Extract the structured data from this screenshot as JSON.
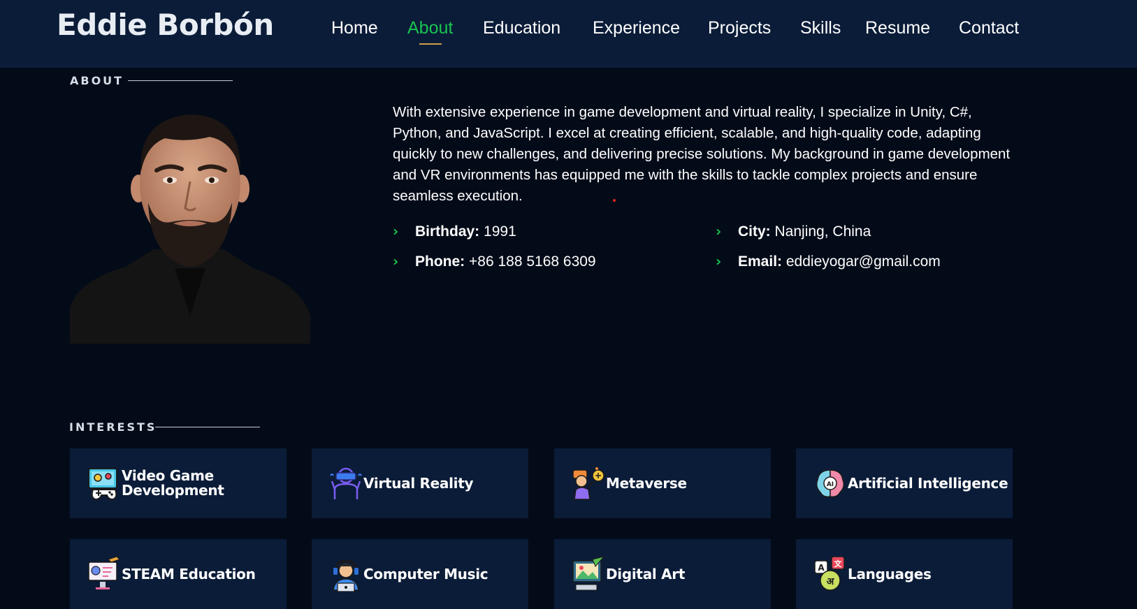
{
  "header": {
    "logo": "Eddie Borbón",
    "nav": [
      {
        "label": "Home"
      },
      {
        "label": "About",
        "active": true
      },
      {
        "label": "Education"
      },
      {
        "label": "Experience"
      },
      {
        "label": "Projects"
      },
      {
        "label": "Skills"
      },
      {
        "label": "Resume"
      },
      {
        "label": "Contact"
      }
    ]
  },
  "about": {
    "title": "ABOUT",
    "bio": "With extensive experience in game development and virtual reality, I specialize in Unity, C#, Python, and JavaScript. I excel at creating efficient, scalable, and high-quality code, adapting quickly to new challenges, and delivering precise solutions. My background in game development and VR environments has equipped me with the skills to tackle complex projects and ensure seamless execution.",
    "details": {
      "birthday": {
        "label": "Birthday:",
        "value": "1991"
      },
      "city": {
        "label": "City:",
        "value": "Nanjing, China"
      },
      "phone": {
        "label": "Phone:",
        "value": "+86 188 5168 6309"
      },
      "email": {
        "label": "Email:",
        "value": "eddieyogar@gmail.com"
      }
    }
  },
  "interests": {
    "title": "INTERESTS",
    "items": [
      {
        "label": "Video Game Development",
        "icon": "gamepad-icon"
      },
      {
        "label": "Virtual Reality",
        "icon": "vr-headset-icon"
      },
      {
        "label": "Metaverse",
        "icon": "metaverse-avatar-icon"
      },
      {
        "label": "Artificial Intelligence",
        "icon": "ai-brain-icon"
      },
      {
        "label": "STEAM Education",
        "icon": "education-screen-icon"
      },
      {
        "label": "Computer Music",
        "icon": "music-producer-icon"
      },
      {
        "label": "Digital Art",
        "icon": "digital-art-icon"
      },
      {
        "label": "Languages",
        "icon": "translate-icon"
      }
    ]
  },
  "colors": {
    "accent": "#18c44f",
    "underline": "#d19e4b",
    "background": "#040b18",
    "panel": "#0b1c38"
  }
}
